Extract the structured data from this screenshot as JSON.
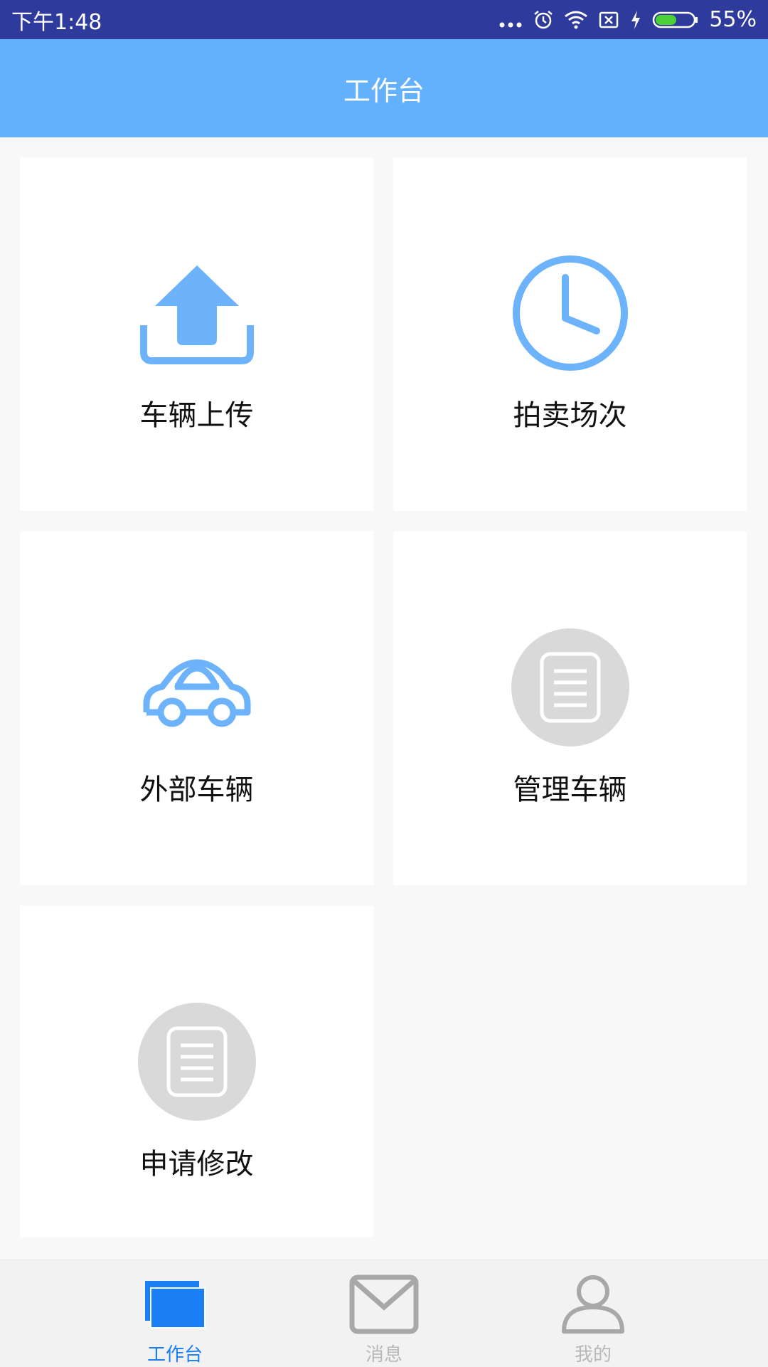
{
  "status_bar": {
    "time": "下午1:48",
    "battery_percent": "55%",
    "battery_level": 0.55,
    "icons": [
      "more-dots-icon",
      "alarm-icon",
      "wifi-icon",
      "no-sim-icon",
      "charging-icon",
      "battery-icon"
    ]
  },
  "header": {
    "title": "工作台"
  },
  "tiles": [
    {
      "label": "车辆上传",
      "icon": "upload-icon",
      "color": "#6cb3fb"
    },
    {
      "label": "拍卖场次",
      "icon": "clock-icon",
      "color": "#6cb3fb"
    },
    {
      "label": "外部车辆",
      "icon": "car-icon",
      "color": "#6cb3fb"
    },
    {
      "label": "管理车辆",
      "icon": "document-icon",
      "color": "#d9d9d9"
    },
    {
      "label": "申请修改",
      "icon": "document-icon",
      "color": "#d9d9d9"
    }
  ],
  "bottom_nav": {
    "items": [
      {
        "label": "工作台",
        "icon": "workbench-icon",
        "active": true
      },
      {
        "label": "消息",
        "icon": "mail-icon",
        "active": false
      },
      {
        "label": "我的",
        "icon": "user-icon",
        "active": false
      }
    ],
    "active_color": "#1a7ef5",
    "inactive_color": "#b8b8b8"
  }
}
